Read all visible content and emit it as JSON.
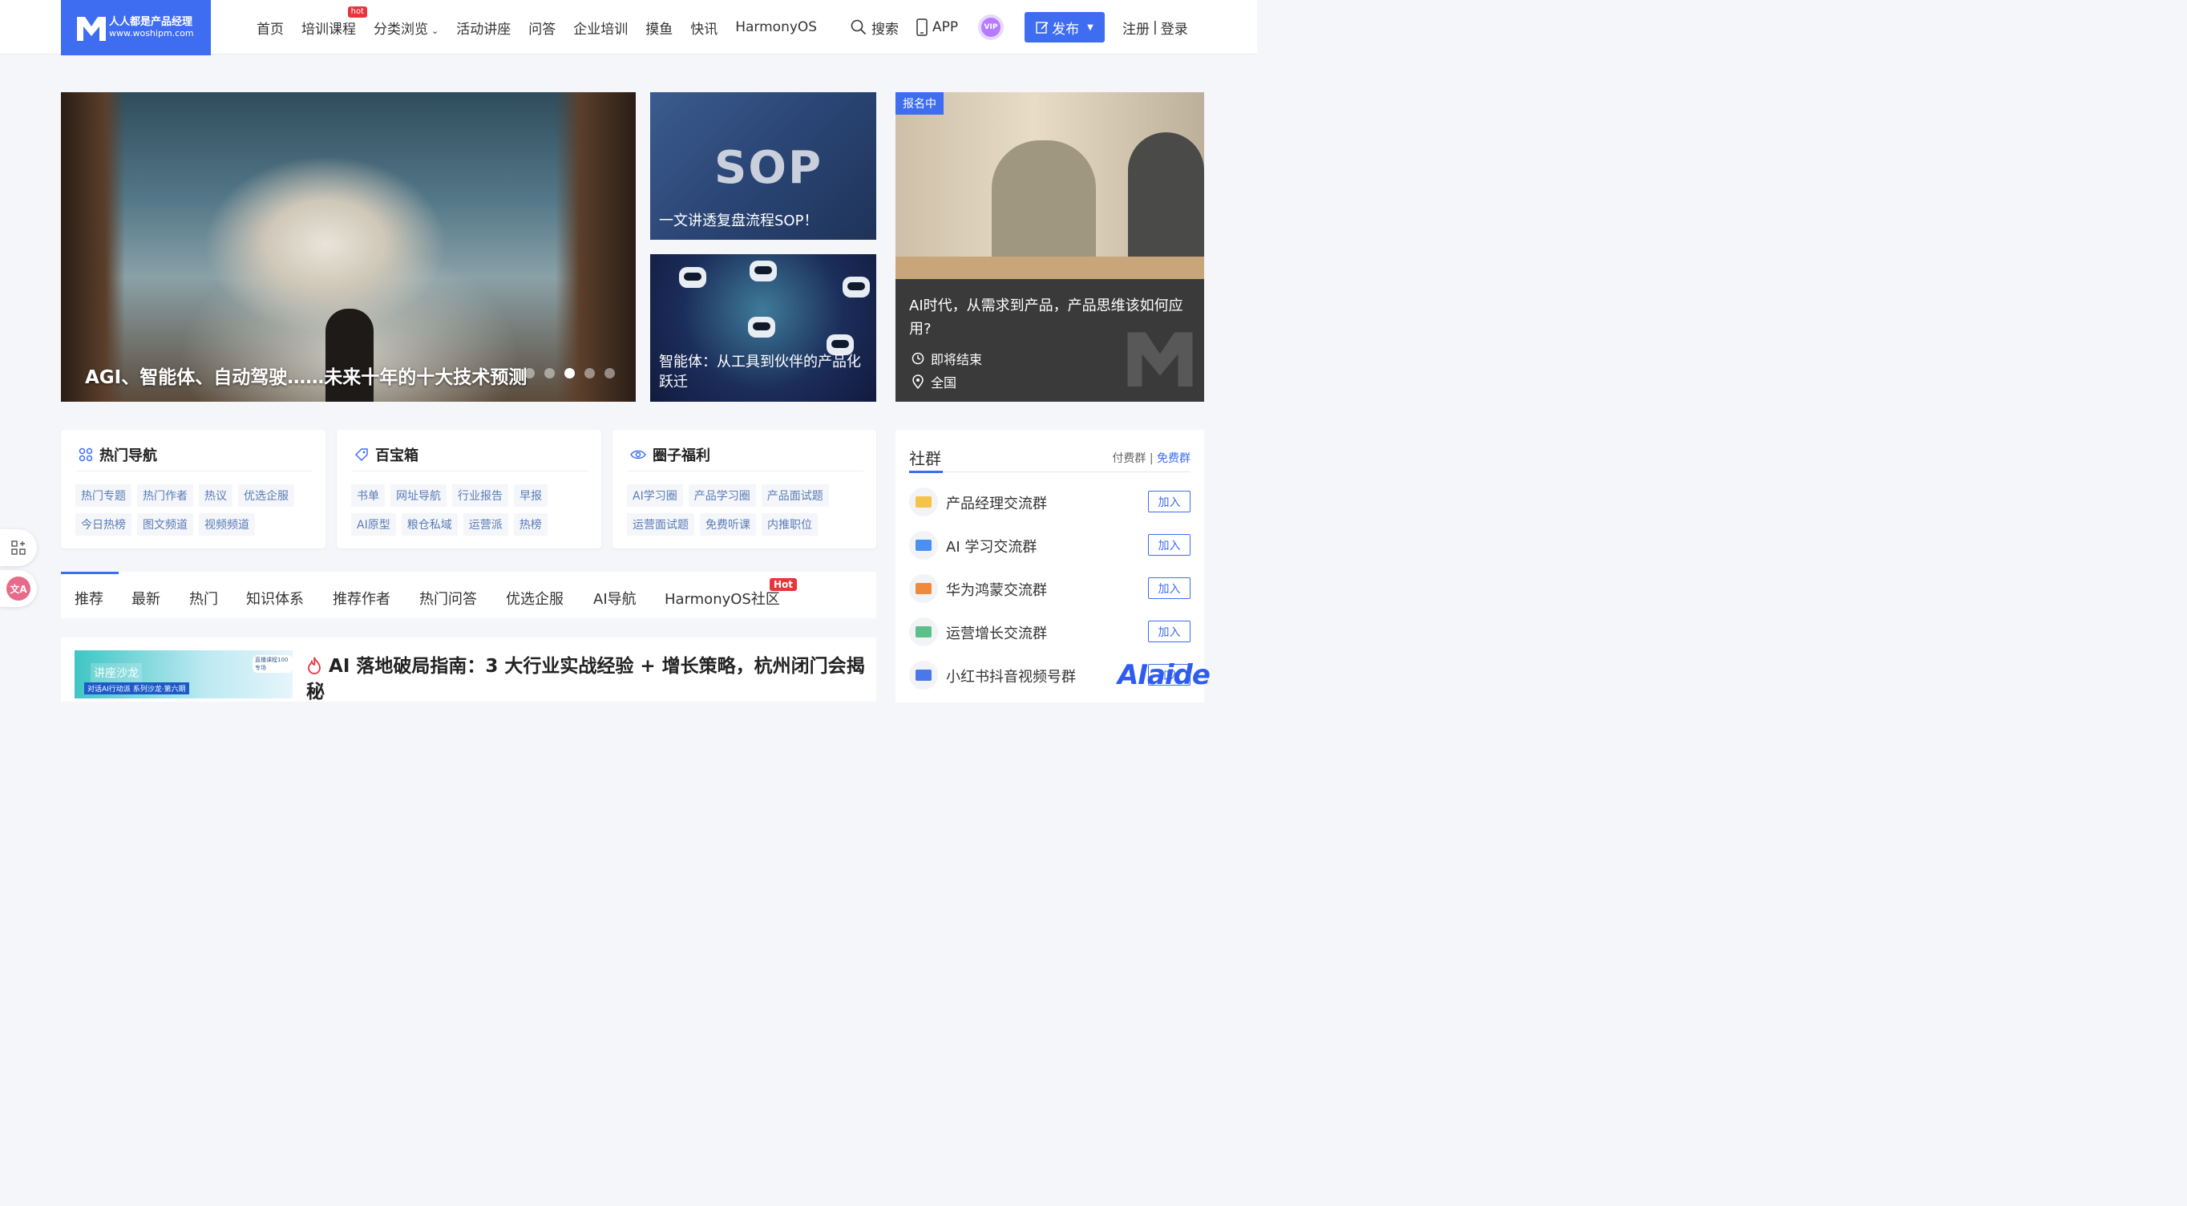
{
  "header": {
    "logo": {
      "line1": "人人都是产品经理",
      "line2": "www.woshipm.com"
    },
    "nav": [
      {
        "label": "首页"
      },
      {
        "label": "培训课程",
        "badge": "hot"
      },
      {
        "label": "分类浏览"
      },
      {
        "label": "活动讲座"
      },
      {
        "label": "问答"
      },
      {
        "label": "企业培训"
      },
      {
        "label": "摸鱼"
      },
      {
        "label": "快讯"
      },
      {
        "label": "HarmonyOS"
      }
    ],
    "search_label": "搜索",
    "app_label": "APP",
    "vip_label": "VIP",
    "publish_label": "发布",
    "register_label": "注册",
    "separator": "|",
    "login_label": "登录"
  },
  "banners": {
    "main": {
      "title": "AGI、智能体、自动驾驶……未来十年的十大技术预测",
      "slide_count": 5,
      "active_slide": 3
    },
    "sop": {
      "image_text": "SOP",
      "title": "一文讲透复盘流程SOP！"
    },
    "agent": {
      "title": "智能体：从工具到伙伴的产品化跃迁"
    },
    "event": {
      "badge": "报名中",
      "title": "AI时代，从需求到产品，产品思维该如何应用?",
      "status": "即将结束",
      "location": "全国"
    }
  },
  "nav_cards": [
    {
      "title": "热门导航",
      "icon": "grid-icon",
      "tags": [
        "热门专题",
        "热门作者",
        "热议",
        "优选企服",
        "今日热榜",
        "图文频道",
        "视频频道"
      ]
    },
    {
      "title": "百宝箱",
      "icon": "tag-icon",
      "tags": [
        "书单",
        "网址导航",
        "行业报告",
        "早报",
        "AI原型",
        "粮仓私域",
        "运营派",
        "热榜"
      ]
    },
    {
      "title": "圈子福利",
      "icon": "eye-icon",
      "tags": [
        "AI学习圈",
        "产品学习圈",
        "产品面试题",
        "运营面试题",
        "免费听课",
        "内推职位"
      ]
    }
  ],
  "tabs": [
    {
      "label": "推荐"
    },
    {
      "label": "最新"
    },
    {
      "label": "热门"
    },
    {
      "label": "知识体系"
    },
    {
      "label": "推荐作者"
    },
    {
      "label": "热门问答"
    },
    {
      "label": "优选企服"
    },
    {
      "label": "AI导航"
    },
    {
      "label": "HarmonyOS社区",
      "badge": "Hot"
    }
  ],
  "article": {
    "thumb_label": "讲座沙龙",
    "thumb_sub": "对话AI行动派",
    "thumb_sub2": "系列沙龙·第六期",
    "thumb_badge": "直播课程100专场",
    "title": "AI 落地破局指南：3 大行业实战经验 + 增长策略，杭州闭门会揭秘"
  },
  "community": {
    "title": "社群",
    "paid_label": "付费群",
    "separator": "|",
    "free_label": "免费群",
    "groups": [
      {
        "name": "产品经理交流群",
        "join": "加入",
        "color": "#f5c24a"
      },
      {
        "name": "AI 学习交流群",
        "join": "加入",
        "color": "#4a90f0"
      },
      {
        "name": "华为鸿蒙交流群",
        "join": "加入",
        "color": "#f08a3a"
      },
      {
        "name": "运营增长交流群",
        "join": "加入",
        "color": "#5bc08a"
      },
      {
        "name": "小红书抖音视频号群",
        "join": "加入",
        "color": "#4a78e8"
      }
    ]
  },
  "watermark": "AIaide",
  "colors": {
    "brand": "#3e6df2",
    "hot": "#e8343b"
  }
}
